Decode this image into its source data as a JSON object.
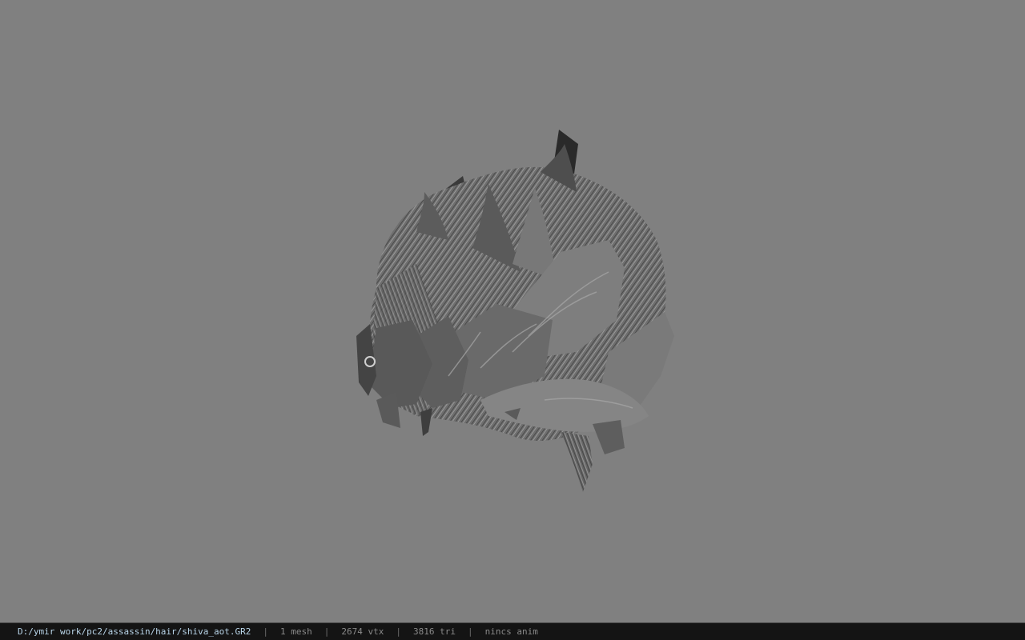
{
  "viewer": {
    "model": {
      "description_icon": "hair-mesh-model",
      "fill": "#6a6a6a",
      "shade_dark": "#2e2e2e",
      "shade_light": "#9a9a9a"
    },
    "background_color": "#808080"
  },
  "statusbar": {
    "file_path": "D:/ymir work/pc2/assassin/hair/shiva_aot.GR2",
    "mesh_count": "1 mesh",
    "vertex_count": "2674 vtx",
    "triangle_count": "3816 tri",
    "anim_info": "nincs anim",
    "separator": "|"
  }
}
